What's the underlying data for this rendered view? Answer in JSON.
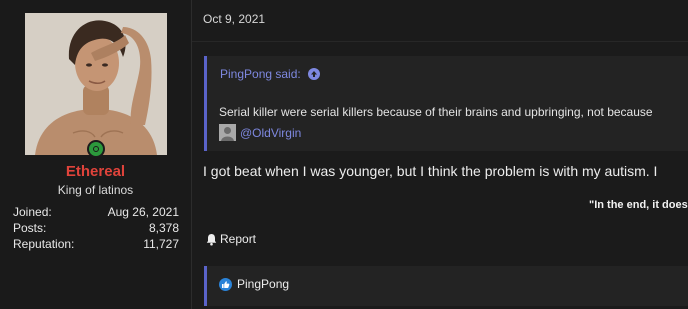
{
  "user": {
    "username": "Ethereal",
    "title": "King of latinos",
    "online": true,
    "stats": [
      {
        "label": "Joined:",
        "value": "Aug 26, 2021"
      },
      {
        "label": "Posts:",
        "value": "8,378"
      },
      {
        "label": "Reputation:",
        "value": "11,727"
      }
    ],
    "username_color": "#e0433b"
  },
  "post": {
    "date": "Oct 9, 2021",
    "quote": {
      "author_line": "PingPong said:",
      "text": "Serial killer were serial killers because of their brains and upbringing, not because",
      "mention": "@OldVirgin"
    },
    "body": "I got beat when I was younger, but I think the problem is with my autism. I",
    "signature": "\"In the end, it does",
    "report_label": "Report",
    "reactions": {
      "icon": "like-icon",
      "users": "PingPong"
    }
  },
  "icons": {
    "online": "online-status-icon",
    "quote_jump": "arrow-up-circle-icon",
    "report": "bell-icon",
    "reaction": "like-icon"
  },
  "colors": {
    "accent": "#5a63c9",
    "link": "#7e88e0",
    "online": "#2c9a3c",
    "like": "#2a83d8"
  }
}
